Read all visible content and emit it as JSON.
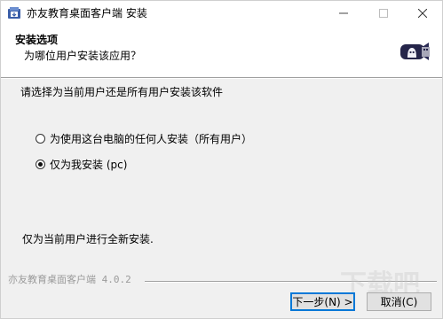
{
  "window": {
    "title": "亦友教育桌面客户端 安装",
    "icon": "installer-app-icon",
    "controls": {
      "minimize": "minimize-icon",
      "maximize": "maximize-icon",
      "close": "close-icon"
    }
  },
  "header": {
    "title": "安装选项",
    "subtitle": "为哪位用户安装该应用？",
    "logo": "usb-drive-icon",
    "logo_color": "#2b2b55"
  },
  "body": {
    "prompt": "请选择为当前用户还是所有用户安装该软件",
    "options": [
      {
        "label": "为使用这台电脑的任何人安装（所有用户）",
        "checked": false
      },
      {
        "label": "仅为我安装 (pc)",
        "checked": true
      }
    ],
    "info": "仅为当前用户进行全新安装."
  },
  "footer": {
    "brand": "亦友教育桌面客户端 4.0.2",
    "next_label": "下一步(N) >",
    "cancel_label": "取消(C)"
  },
  "colors": {
    "accent": "#0078d7",
    "background": "#f0f0f0",
    "header_bg": "#ffffff"
  }
}
